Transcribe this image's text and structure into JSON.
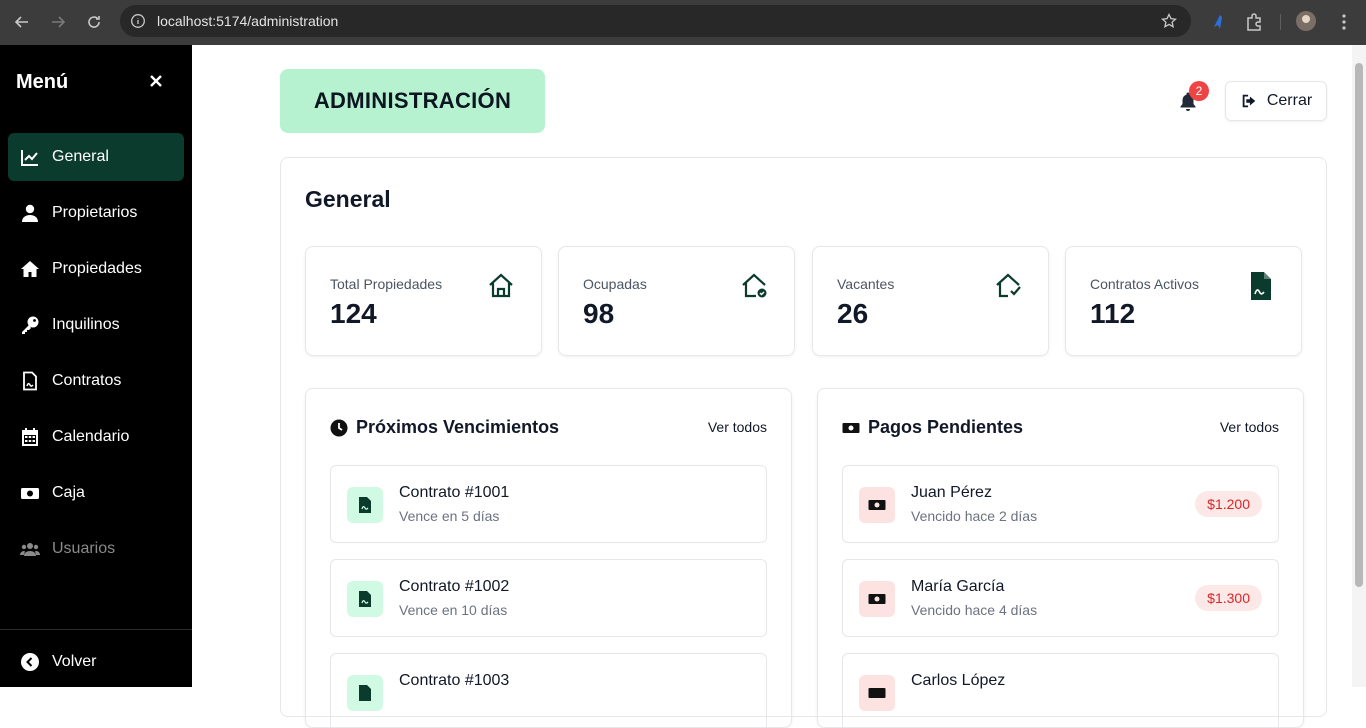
{
  "browser": {
    "url": "localhost:5174/administration"
  },
  "sidebar": {
    "title": "Menú",
    "items": [
      {
        "label": "General",
        "icon": "chart-line-icon",
        "active": true
      },
      {
        "label": "Propietarios",
        "icon": "user-icon"
      },
      {
        "label": "Propiedades",
        "icon": "home-icon"
      },
      {
        "label": "Inquilinos",
        "icon": "key-icon"
      },
      {
        "label": "Contratos",
        "icon": "contract-file-icon"
      },
      {
        "label": "Calendario",
        "icon": "calendar-icon"
      },
      {
        "label": "Caja",
        "icon": "money-bill-icon"
      },
      {
        "label": "Usuarios",
        "icon": "users-icon",
        "muted": true
      }
    ],
    "back_label": "Volver"
  },
  "header": {
    "badge": "ADMINISTRACIÓN",
    "notifications": "2",
    "logout_label": "Cerrar"
  },
  "main": {
    "title": "General",
    "stats": [
      {
        "label": "Total Propiedades",
        "value": "124",
        "icon": "home-icon"
      },
      {
        "label": "Ocupadas",
        "value": "98",
        "icon": "home-check-icon"
      },
      {
        "label": "Vacantes",
        "value": "26",
        "icon": "home-vacant-icon"
      },
      {
        "label": "Contratos Activos",
        "value": "112",
        "icon": "contract-file-icon"
      }
    ],
    "expirations": {
      "title": "Próximos Vencimientos",
      "see_all": "Ver todos",
      "items": [
        {
          "title": "Contrato #1001",
          "subtitle": "Vence en 5 días"
        },
        {
          "title": "Contrato #1002",
          "subtitle": "Vence en 10 días"
        },
        {
          "title": "Contrato #1003",
          "subtitle": ""
        }
      ]
    },
    "payments": {
      "title": "Pagos Pendientes",
      "see_all": "Ver todos",
      "items": [
        {
          "name": "Juan Pérez",
          "subtitle": "Vencido hace 2 días",
          "amount": "$1.200"
        },
        {
          "name": "María García",
          "subtitle": "Vencido hace 4 días",
          "amount": "$1.300"
        },
        {
          "name": "Carlos López",
          "subtitle": "",
          "amount": ""
        }
      ]
    }
  },
  "colors": {
    "sidebar_active": "#0b3b2d",
    "badge_bg": "#b7f2d0",
    "accent_red": "#dc2626"
  }
}
